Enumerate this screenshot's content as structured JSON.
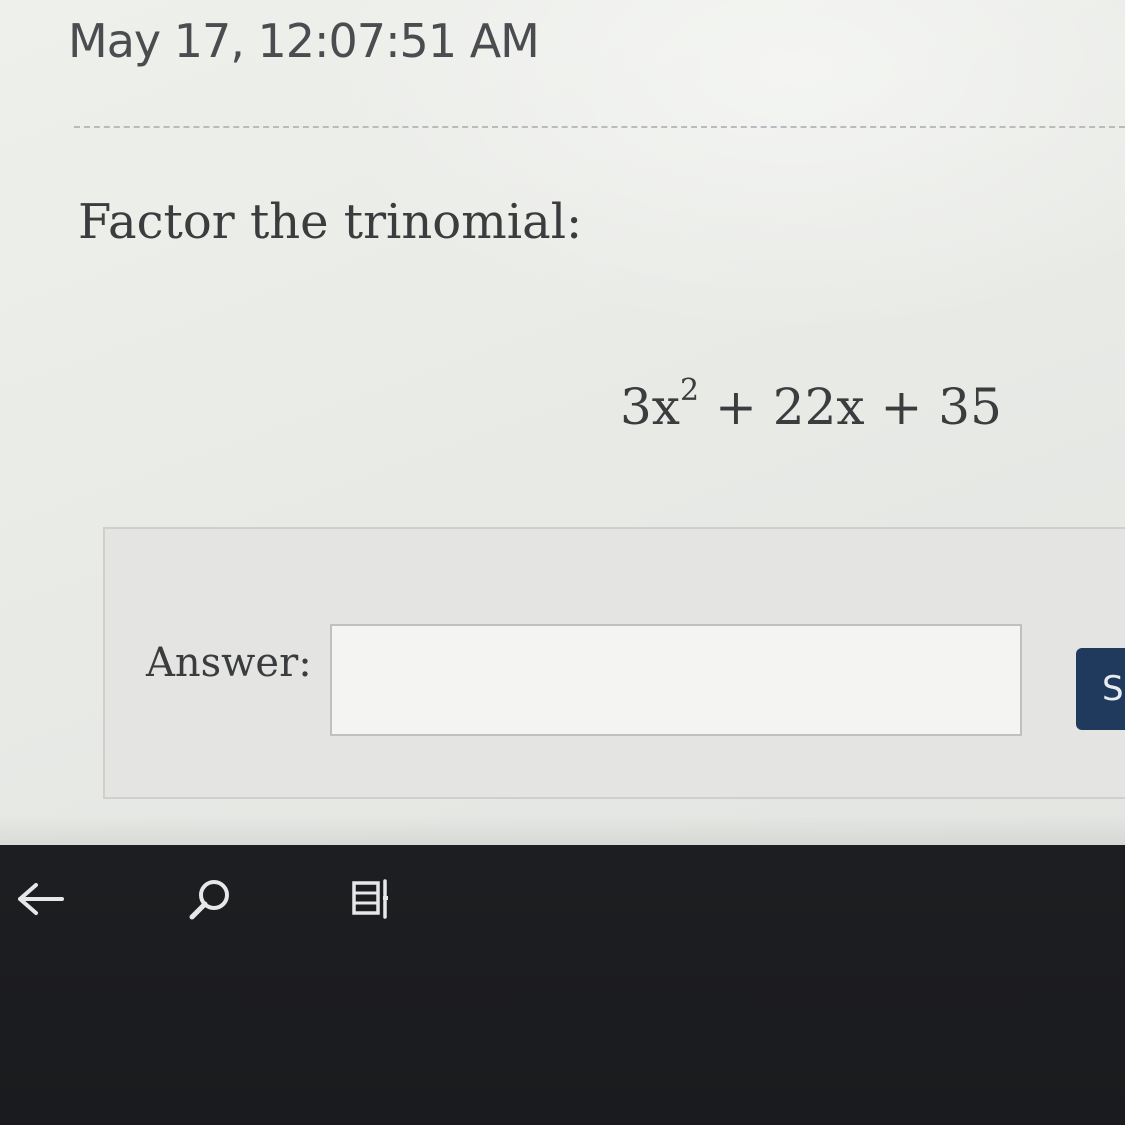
{
  "header": {
    "timestamp": "May 17, 12:07:51 AM"
  },
  "question": {
    "prompt": "Factor the trinomial:",
    "expression": {
      "term1_coef_var": "3x",
      "term1_exponent": "2",
      "rest": " + 22x + 35"
    }
  },
  "answer": {
    "label": "Answer:",
    "input_value": "",
    "input_placeholder": "",
    "submit_label": "S"
  },
  "taskbar": {
    "icons": [
      "back-arrow-icon",
      "search-icon",
      "task-view-icon"
    ]
  },
  "colors": {
    "page_background": "#e9ebe7",
    "submit_button": "#1f3a5c",
    "taskbar": "#1f2023"
  }
}
